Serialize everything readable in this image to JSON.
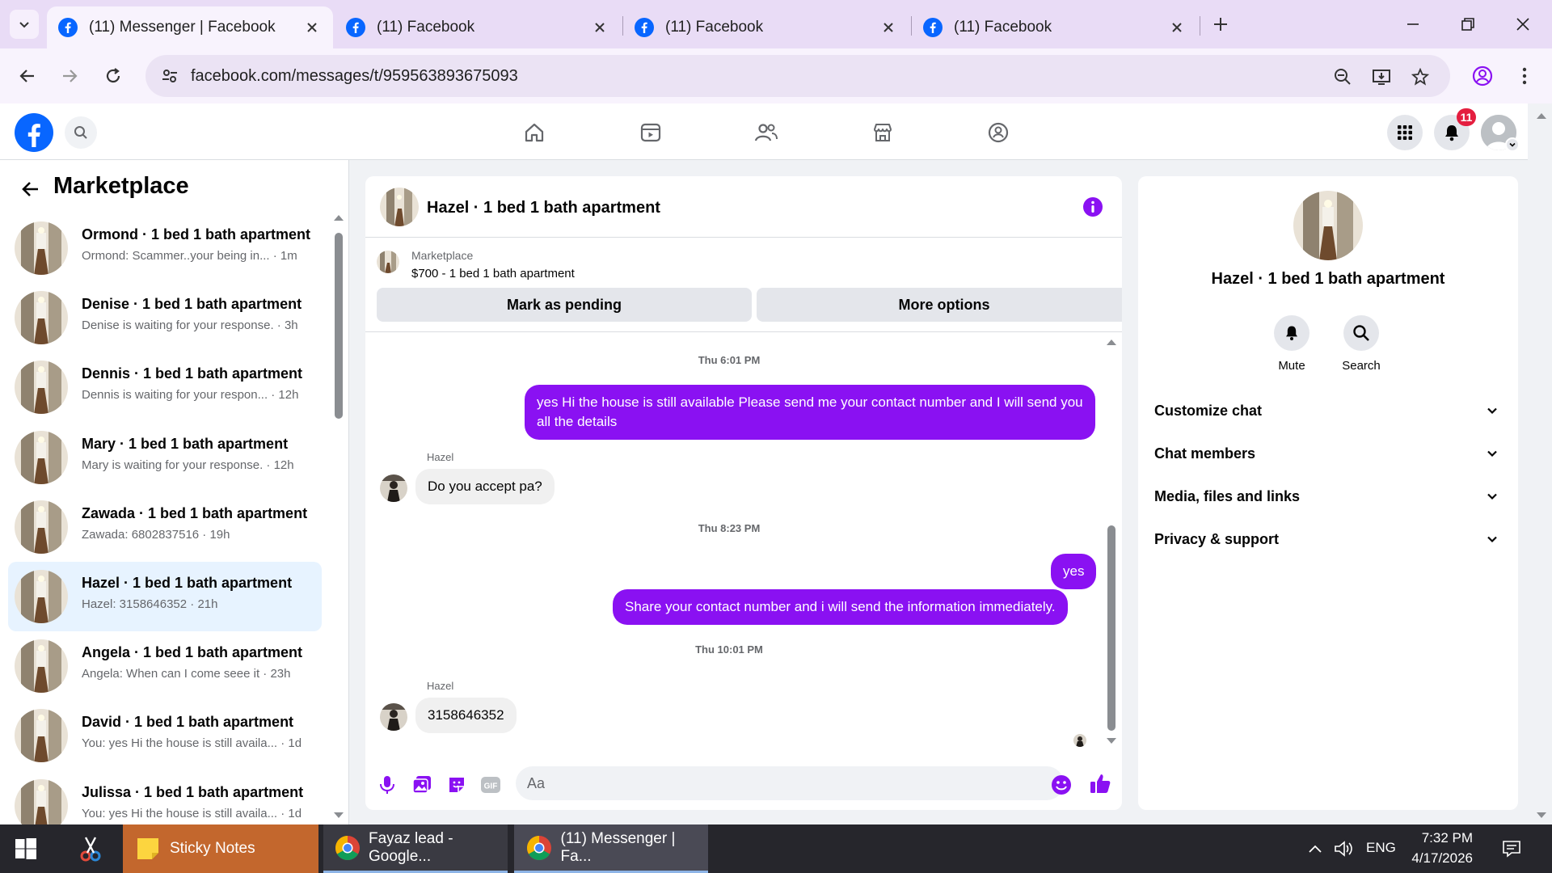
{
  "browser": {
    "tabs": [
      {
        "title": "(11) Messenger | Facebook",
        "active": true
      },
      {
        "title": "(11) Facebook",
        "active": false
      },
      {
        "title": "(11) Facebook",
        "active": false
      },
      {
        "title": "(11) Facebook",
        "active": false
      }
    ],
    "url": "facebook.com/messages/t/959563893675093"
  },
  "header": {
    "notification_count": "11"
  },
  "sidebar": {
    "title": "Marketplace",
    "conversations": [
      {
        "name": "Ormond · 1 bed 1 bath apartment",
        "preview": "Ormond: Scammer..your being in... · 1m",
        "selected": false
      },
      {
        "name": "Denise · 1 bed 1 bath apartment",
        "preview": "Denise is waiting for your response. · 3h",
        "selected": false
      },
      {
        "name": "Dennis · 1 bed 1 bath apartment",
        "preview": "Dennis is waiting for your respon... · 12h",
        "selected": false
      },
      {
        "name": "Mary · 1 bed 1 bath apartment",
        "preview": "Mary is waiting for your response. · 12h",
        "selected": false
      },
      {
        "name": "Zawada · 1 bed 1 bath apartment",
        "preview": "Zawada: 6802837516 · 19h",
        "selected": false
      },
      {
        "name": "Hazel · 1 bed 1 bath apartment",
        "preview": "Hazel: 3158646352 · 21h",
        "selected": true
      },
      {
        "name": "Angela · 1 bed 1 bath apartment",
        "preview": "Angela: When can I come seee it · 23h",
        "selected": false
      },
      {
        "name": "David · 1 bed 1 bath apartment",
        "preview": "You: yes Hi the house is still availa... · 1d",
        "selected": false
      },
      {
        "name": "Julissa · 1 bed 1 bath apartment",
        "preview": "You: yes Hi the house is still availa... · 1d",
        "selected": false
      }
    ]
  },
  "chat": {
    "title": "Hazel · 1 bed 1 bath apartment",
    "listing_label": "Marketplace",
    "listing_price": "$700 - 1 bed 1 bath apartment",
    "mark_pending": "Mark as pending",
    "more_options": "More options",
    "ts1": "Thu 6:01 PM",
    "msg1": "yes Hi the house is still available Please send me your contact number and I will send you all the details",
    "sender1": "Hazel",
    "msg2": "Do you accept pa?",
    "ts2": "Thu 8:23 PM",
    "msg3": "yes",
    "msg4": "Share your contact number and i will send the information immediately.",
    "ts3": "Thu 10:01 PM",
    "sender2": "Hazel",
    "msg5": "3158646352",
    "input_placeholder": "Aa",
    "gif_label": "GIF"
  },
  "details": {
    "title": "Hazel · 1 bed 1 bath apartment",
    "mute": "Mute",
    "search": "Search",
    "rows": [
      "Customize chat",
      "Chat members",
      "Media, files and links",
      "Privacy & support"
    ]
  },
  "taskbar": {
    "apps": [
      "Sticky Notes",
      "Fayaz lead - Google...",
      "(11) Messenger | Fa..."
    ],
    "lang": "ENG",
    "time": "7:32 PM",
    "date": "4/17/2026"
  },
  "colors": {
    "accent": "#8a11f2",
    "fb_blue": "#0866ff",
    "selected_bg": "#e7f3ff"
  }
}
